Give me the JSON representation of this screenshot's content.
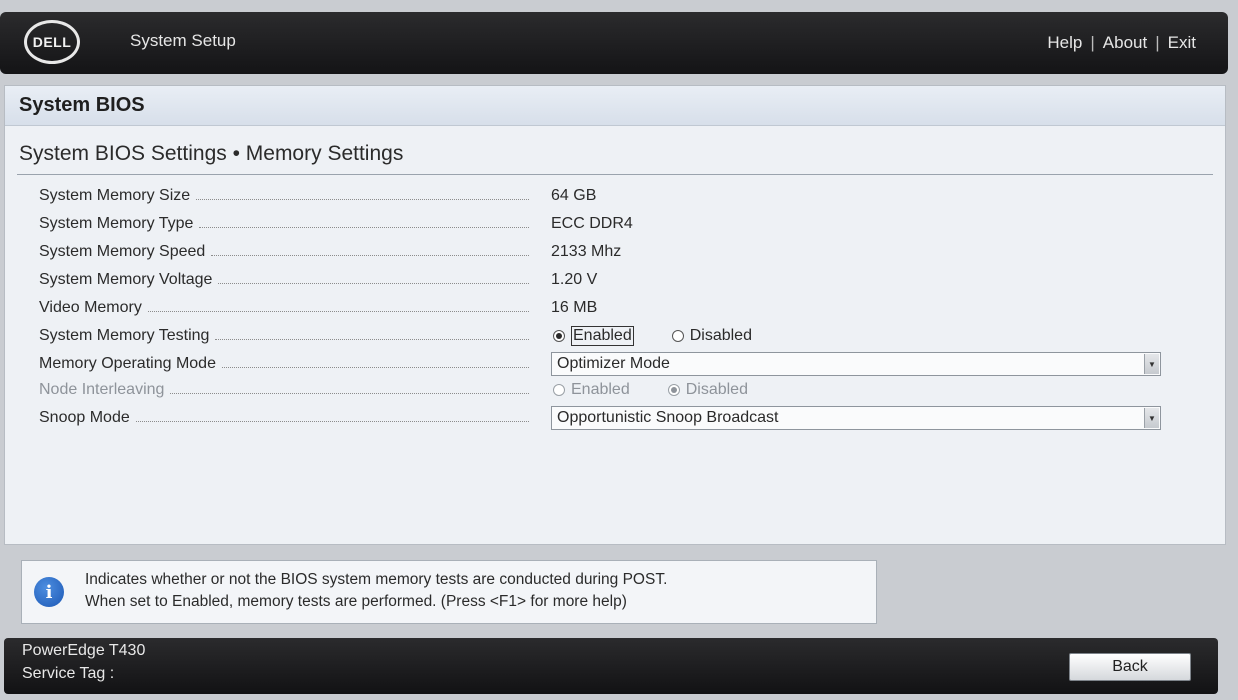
{
  "header": {
    "logo_text": "DELL",
    "app_title": "System Setup",
    "links": {
      "help": "Help",
      "about": "About",
      "exit": "Exit",
      "separator": "|"
    }
  },
  "page": {
    "section_title": "System BIOS",
    "breadcrumb": "System BIOS Settings • Memory Settings"
  },
  "settings": {
    "memory_size": {
      "label": "System Memory Size",
      "value": "64 GB"
    },
    "memory_type": {
      "label": "System Memory Type",
      "value": "ECC DDR4"
    },
    "memory_speed": {
      "label": "System Memory Speed",
      "value": "2133 Mhz"
    },
    "memory_voltage": {
      "label": "System Memory Voltage",
      "value": "1.20 V"
    },
    "video_memory": {
      "label": "Video Memory",
      "value": "16 MB"
    },
    "memory_testing": {
      "label": "System Memory Testing",
      "options": [
        "Enabled",
        "Disabled"
      ],
      "selected": "Enabled"
    },
    "operating_mode": {
      "label": "Memory Operating Mode",
      "value": "Optimizer Mode"
    },
    "node_interleaving": {
      "label": "Node Interleaving",
      "options": [
        "Enabled",
        "Disabled"
      ],
      "selected": "Disabled",
      "disabled": true
    },
    "snoop_mode": {
      "label": "Snoop Mode",
      "value": "Opportunistic Snoop Broadcast"
    }
  },
  "help": {
    "icon": "info-icon",
    "line1": "Indicates whether or not the BIOS system memory tests are conducted during POST.",
    "line2": "When set to Enabled, memory tests are performed. (Press <F1> for more help)"
  },
  "footer": {
    "model": "PowerEdge T430",
    "service_tag_label": "Service Tag :",
    "back_label": "Back"
  }
}
